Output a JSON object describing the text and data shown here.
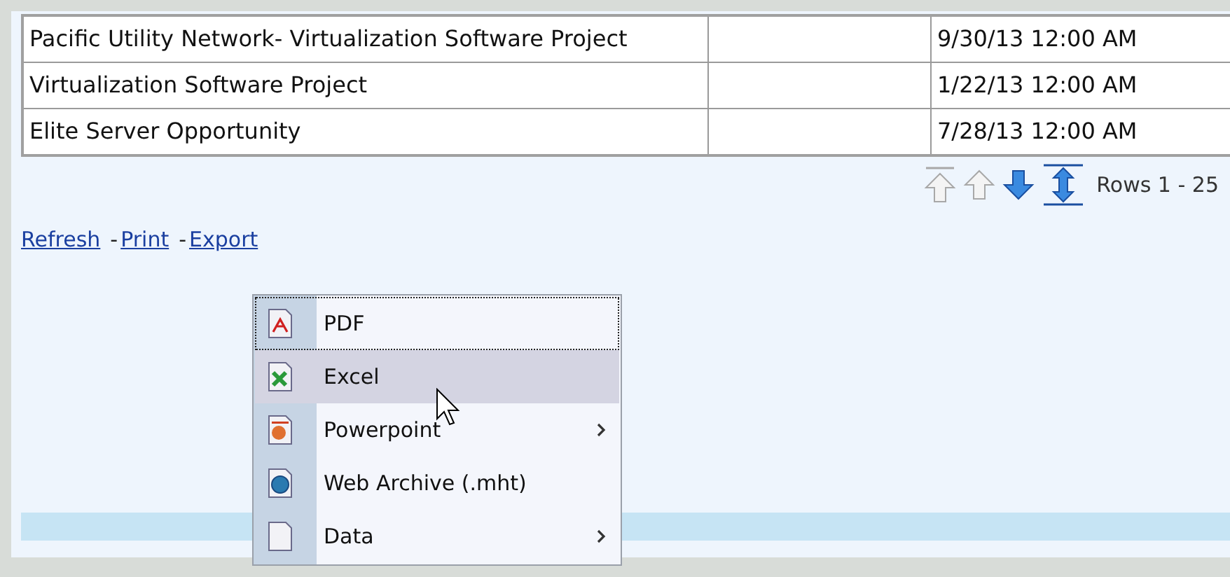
{
  "table": {
    "rows": [
      {
        "cells": [
          "Pacific Utility Network- Virtualization Software Project",
          "",
          "9/30/13 12:00 AM"
        ]
      },
      {
        "cells": [
          "Virtualization Software Project",
          "",
          "1/22/13 12:00 AM"
        ]
      },
      {
        "cells": [
          "Elite Server Opportunity",
          "",
          "7/28/13 12:00 AM"
        ]
      }
    ]
  },
  "pager": {
    "buttons": [
      {
        "kind": "first",
        "disabled": true
      },
      {
        "kind": "previous",
        "disabled": true
      },
      {
        "kind": "next",
        "disabled": false
      },
      {
        "kind": "last",
        "disabled": false
      }
    ],
    "label": "Rows 1 - 25"
  },
  "links": [
    {
      "label": "Refresh"
    },
    {
      "label": "Print",
      "separator": "-"
    },
    {
      "label": "Export",
      "separator": "-"
    }
  ],
  "export_menu": {
    "items": [
      {
        "kind": "pdf",
        "label": "PDF",
        "highlighted": false,
        "focused": true,
        "has_submenu": false
      },
      {
        "kind": "excel",
        "label": "Excel",
        "highlighted": true,
        "focused": false,
        "has_submenu": false
      },
      {
        "kind": "powerpoint",
        "label": "Powerpoint",
        "highlighted": false,
        "focused": false,
        "has_submenu": true
      },
      {
        "kind": "web",
        "label": "Web Archive (.mht)",
        "highlighted": false,
        "focused": false,
        "has_submenu": false
      },
      {
        "kind": "data",
        "label": "Data",
        "highlighted": false,
        "focused": false,
        "has_submenu": true
      }
    ]
  }
}
